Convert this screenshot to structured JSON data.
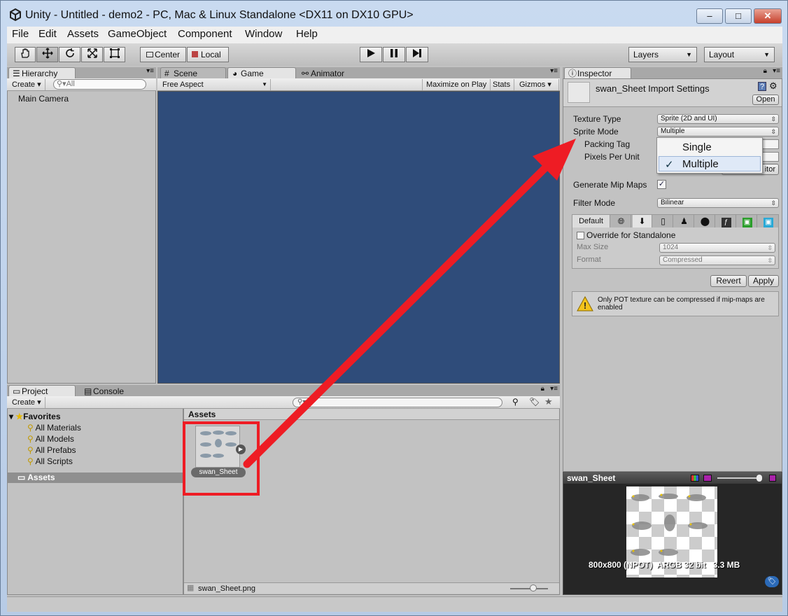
{
  "window": {
    "title": "Unity - Untitled - demo2 - PC, Mac & Linux Standalone <DX11 on DX10 GPU>",
    "min_label": "–",
    "max_label": "□",
    "close_label": "✕"
  },
  "menu": [
    "File",
    "Edit",
    "Assets",
    "GameObject",
    "Component",
    "Window",
    "Help"
  ],
  "toolbar": {
    "tools": [
      "hand",
      "move",
      "rotate",
      "scale",
      "rect"
    ],
    "pivot_label": "Center",
    "space_label": "Local",
    "play_icons": [
      "play",
      "pause",
      "step"
    ],
    "layers_label": "Layers",
    "layout_label": "Layout"
  },
  "hierarchy": {
    "tab_label": "Hierarchy",
    "create_label": "Create",
    "search_placeholder": "All",
    "items": [
      "Main Camera"
    ]
  },
  "scene_tabs": [
    {
      "label": "Scene"
    },
    {
      "label": "Game"
    },
    {
      "label": "Animator"
    }
  ],
  "game": {
    "aspect_label": "Free Aspect",
    "maximize_label": "Maximize on Play",
    "stats_label": "Stats",
    "gizmos_label": "Gizmos",
    "bg_color": "#2f4c7a"
  },
  "project": {
    "tab_label": "Project",
    "console_label": "Console",
    "create_label": "Create",
    "favorites_label": "Favorites",
    "favorites": [
      "All Materials",
      "All Models",
      "All Prefabs",
      "All Scripts"
    ],
    "assets_label": "Assets",
    "assets_header": "Assets",
    "asset_name": "swan_Sheet",
    "status_file": "swan_Sheet.png"
  },
  "inspector": {
    "tab_label": "Inspector",
    "title": "swan_Sheet Import Settings",
    "open_label": "Open",
    "texture_type_label": "Texture Type",
    "texture_type_value": "Sprite (2D and UI)",
    "sprite_mode_label": "Sprite Mode",
    "sprite_mode_value": "Multiple",
    "packing_tag_label": "Packing Tag",
    "pixels_per_unit_label": "Pixels Per Unit",
    "sprite_editor_partial": "itor",
    "mip_maps_label": "Generate Mip Maps",
    "filter_mode_label": "Filter Mode",
    "filter_mode_value": "Bilinear",
    "platform_default": "Default",
    "override_label": "Override for Standalone",
    "max_size_label": "Max Size",
    "max_size_value": "1024",
    "format_label": "Format",
    "format_value": "Compressed",
    "revert_label": "Revert",
    "apply_label": "Apply",
    "warning_text": "Only POT texture can be compressed if mip-maps are enabled"
  },
  "dropdown": {
    "options": [
      "Single",
      "Multiple"
    ],
    "selected": "Multiple",
    "check": "✓"
  },
  "preview": {
    "title": "swan_Sheet",
    "info": "800x800 (NPOT)  ARGB 32 bit   3.3 MB"
  },
  "annotation": {
    "arrow_color": "#ee1c24",
    "box_color": "#ee1c24"
  }
}
